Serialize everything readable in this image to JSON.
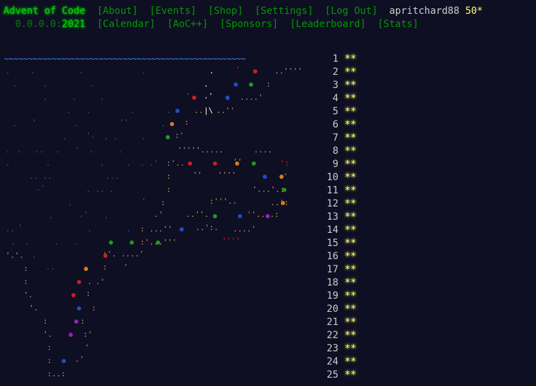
{
  "header": {
    "title": "Advent of Code",
    "nav": [
      "[About]",
      "[Events]",
      "[Shop]",
      "[Settings]",
      "[Log Out]"
    ],
    "user": "apritchard88",
    "star_count": "50*",
    "year_prefix": "0.0.0.0:",
    "year": "2021",
    "subnav": [
      "[Calendar]",
      "[AoC++]",
      "[Sponsors]",
      "[Leaderboard]",
      "[Stats]"
    ]
  },
  "calendar": {
    "wave": "~~~~~~~~~~~~~~~~~~~~~~~~~~~~~~~~~~~~~~~~~~~~~~~~~~~",
    "days": [
      {
        "day": "1",
        "stars": "**"
      },
      {
        "day": "2",
        "stars": "**"
      },
      {
        "day": "3",
        "stars": "**"
      },
      {
        "day": "4",
        "stars": "**"
      },
      {
        "day": "5",
        "stars": "**"
      },
      {
        "day": "6",
        "stars": "**"
      },
      {
        "day": "7",
        "stars": "**"
      },
      {
        "day": "8",
        "stars": "**"
      },
      {
        "day": "9",
        "stars": "**"
      },
      {
        "day": "10",
        "stars": "**"
      },
      {
        "day": "11",
        "stars": "**"
      },
      {
        "day": "12",
        "stars": "**"
      },
      {
        "day": "13",
        "stars": "**"
      },
      {
        "day": "14",
        "stars": "**"
      },
      {
        "day": "15",
        "stars": "**"
      },
      {
        "day": "16",
        "stars": "**"
      },
      {
        "day": "17",
        "stars": "**"
      },
      {
        "day": "18",
        "stars": "**"
      },
      {
        "day": "19",
        "stars": "**"
      },
      {
        "day": "20",
        "stars": "**"
      },
      {
        "day": "21",
        "stars": "**"
      },
      {
        "day": "22",
        "stars": "**"
      },
      {
        "day": "23",
        "stars": "**"
      },
      {
        "day": "24",
        "stars": "**"
      },
      {
        "day": "25",
        "stars": "**"
      }
    ]
  },
  "colors": {
    "background": "#0f0f23",
    "title_green": "#00cc00",
    "link_green": "#009900",
    "star_yellow": "#ffff66",
    "wave_blue": "#4488ff"
  }
}
